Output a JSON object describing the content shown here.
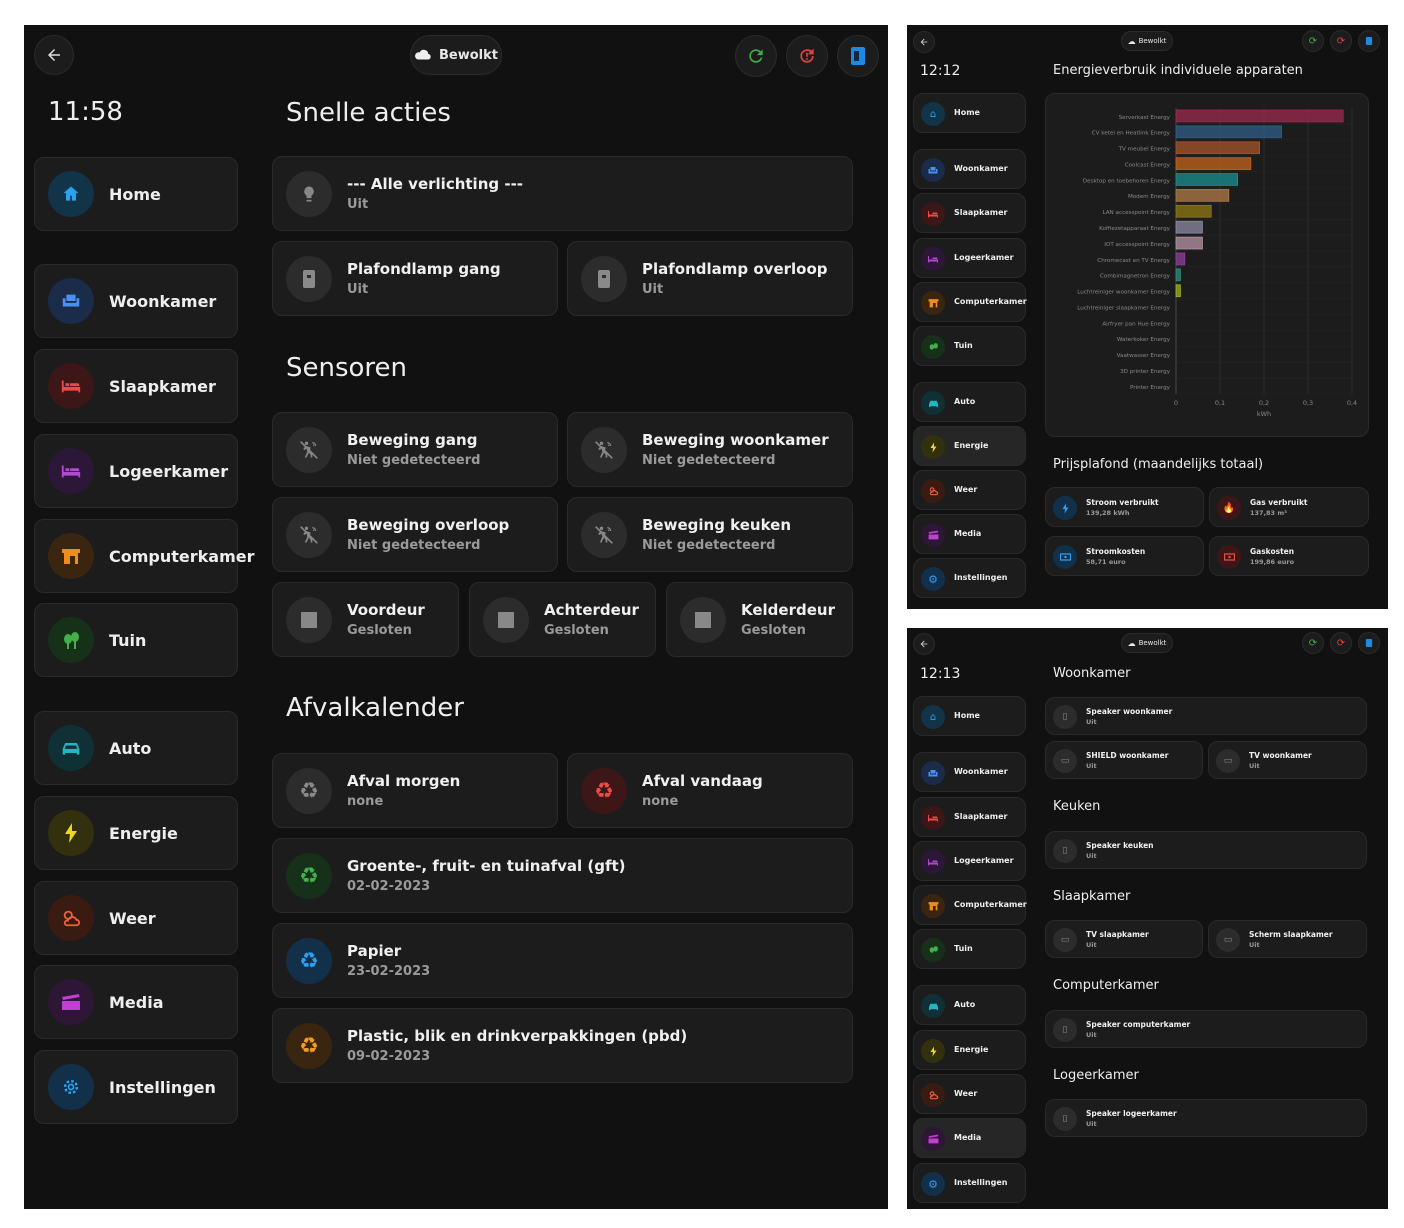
{
  "p1": {
    "weather": "Bewolkt",
    "time": "11:58",
    "nav": [
      "Home",
      "Woonkamer",
      "Slaapkamer",
      "Logeerkamer",
      "Computerkamer",
      "Tuin",
      "Auto",
      "Energie",
      "Weer",
      "Media",
      "Instellingen"
    ],
    "sec_quick": "Snelle acties",
    "all_light": {
      "name": "--- Alle verlichting ---",
      "state": "Uit"
    },
    "lamp1": {
      "name": "Plafondlamp gang",
      "state": "Uit"
    },
    "lamp2": {
      "name": "Plafondlamp overloop",
      "state": "Uit"
    },
    "sec_sensors": "Sensoren",
    "mot1": {
      "name": "Beweging gang",
      "state": "Niet gedetecteerd"
    },
    "mot2": {
      "name": "Beweging woonkamer",
      "state": "Niet gedetecteerd"
    },
    "mot3": {
      "name": "Beweging overloop",
      "state": "Niet gedetecteerd"
    },
    "mot4": {
      "name": "Beweging keuken",
      "state": "Niet gedetecteerd"
    },
    "door1": {
      "name": "Voordeur",
      "state": "Gesloten"
    },
    "door2": {
      "name": "Achterdeur",
      "state": "Gesloten"
    },
    "door3": {
      "name": "Kelderdeur",
      "state": "Gesloten"
    },
    "sec_waste": "Afvalkalender",
    "w1": {
      "name": "Afval morgen",
      "state": "none"
    },
    "w2": {
      "name": "Afval vandaag",
      "state": "none"
    },
    "w3": {
      "name": "Groente-, fruit- en tuinafval (gft)",
      "state": "02-02-2023"
    },
    "w4": {
      "name": "Papier",
      "state": "23-02-2023"
    },
    "w5": {
      "name": "Plastic, blik en drinkverpakkingen (pbd)",
      "state": "09-02-2023"
    }
  },
  "p2": {
    "weather": "Bewolkt",
    "time": "12:12",
    "nav": [
      "Home",
      "Woonkamer",
      "Slaapkamer",
      "Logeerkamer",
      "Computerkamer",
      "Tuin",
      "Auto",
      "Energie",
      "Weer",
      "Media",
      "Instellingen"
    ],
    "title": "Energieverbruik individuele apparaten",
    "sec_price": "Prijsplafond (maandelijks totaal)",
    "stroom": {
      "name": "Stroom verbruikt",
      "value": "139,28 kWh"
    },
    "gas": {
      "name": "Gas verbruikt",
      "value": "137,83 m³"
    },
    "stroomk": {
      "name": "Stroomkosten",
      "value": "58,71 euro"
    },
    "gask": {
      "name": "Gaskosten",
      "value": "199,86 euro"
    }
  },
  "chart_data": {
    "type": "bar",
    "orientation": "horizontal",
    "categories": [
      "Serverkast Energy",
      "CV ketel en Heatlink Energy",
      "TV meubel Energy",
      "Coolcast Energy",
      "Desktop en toebehoren Energy",
      "Modem Energy",
      "LAN accesspoint Energy",
      "Koffiezetapparaat Energy",
      "IOT accesspoint Energy",
      "Chromecast en TV Energy",
      "Combimagnetron Energy",
      "Luchtreiniger woonkamer Energy",
      "Luchtreiniger slaapkamer Energy",
      "Airfryer pan Hue Energy",
      "Waterkoker Energy",
      "Vaatwasser Energy",
      "3D printer Energy",
      "Printer Energy"
    ],
    "values": [
      0.38,
      0.24,
      0.19,
      0.17,
      0.14,
      0.12,
      0.08,
      0.06,
      0.06,
      0.02,
      0.01,
      0.01,
      0,
      0,
      0,
      0,
      0,
      0
    ],
    "colors": [
      "#9c2a4e",
      "#2f5d8a",
      "#a5542b",
      "#c4641c",
      "#1b8f8f",
      "#b07b47",
      "#8d7a13",
      "#8e8aa6",
      "#b895a8",
      "#8e3f9c",
      "#2f8f7b",
      "#a3b322",
      "#444",
      "#444",
      "#444",
      "#444",
      "#444",
      "#444"
    ],
    "xticks": [
      "0",
      "0,1",
      "0,2",
      "0,3",
      "0,4"
    ],
    "xlim": [
      0,
      0.4
    ],
    "xlabel": "kWh",
    "grid": true
  },
  "p3": {
    "weather": "Bewolkt",
    "time": "12:13",
    "nav": [
      "Home",
      "Woonkamer",
      "Slaapkamer",
      "Logeerkamer",
      "Computerkamer",
      "Tuin",
      "Auto",
      "Energie",
      "Weer",
      "Media",
      "Instellingen"
    ],
    "sec1": "Woonkamer",
    "d1": {
      "name": "Speaker woonkamer",
      "state": "Uit"
    },
    "d2": {
      "name": "SHIELD woonkamer",
      "state": "Uit"
    },
    "d3": {
      "name": "TV woonkamer",
      "state": "Uit"
    },
    "sec2": "Keuken",
    "d4": {
      "name": "Speaker keuken",
      "state": "Uit"
    },
    "sec3": "Slaapkamer",
    "d5": {
      "name": "TV slaapkamer",
      "state": "Uit"
    },
    "d6": {
      "name": "Scherm slaapkamer",
      "state": "Uit"
    },
    "sec4": "Computerkamer",
    "d7": {
      "name": "Speaker computerkamer",
      "state": "Uit"
    },
    "sec5": "Logeerkamer",
    "d8": {
      "name": "Speaker logeerkamer",
      "state": "Uit"
    }
  }
}
